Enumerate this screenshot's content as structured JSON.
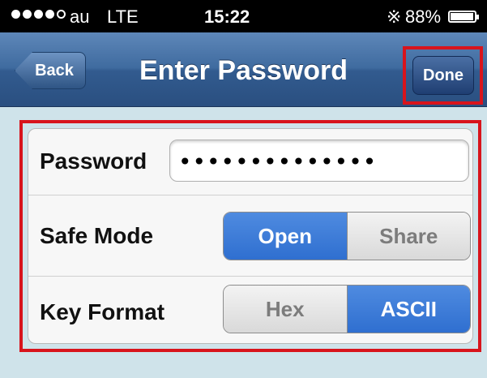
{
  "status_bar": {
    "carrier": "au",
    "network": "LTE",
    "time": "15:22",
    "battery": "88%",
    "bluetooth_icon": "bluetooth-icon",
    "signal_icon": "signal-dots-icon",
    "battery_icon": "battery-icon"
  },
  "nav": {
    "back_label": "Back",
    "title": "Enter Password",
    "done_label": "Done"
  },
  "form": {
    "password": {
      "label": "Password",
      "value": "••••••••••••••"
    },
    "safe_mode": {
      "label": "Safe Mode",
      "options": [
        "Open",
        "Share"
      ],
      "selected": "Open"
    },
    "key_format": {
      "label": "Key Format",
      "options": [
        "Hex",
        "ASCII"
      ],
      "selected": "ASCII"
    }
  },
  "colors": {
    "nav_bar": "#3f6b9f",
    "highlight": "#d8141c",
    "segment_selected": "#2f6fd0",
    "background": "#cfe3ea"
  }
}
